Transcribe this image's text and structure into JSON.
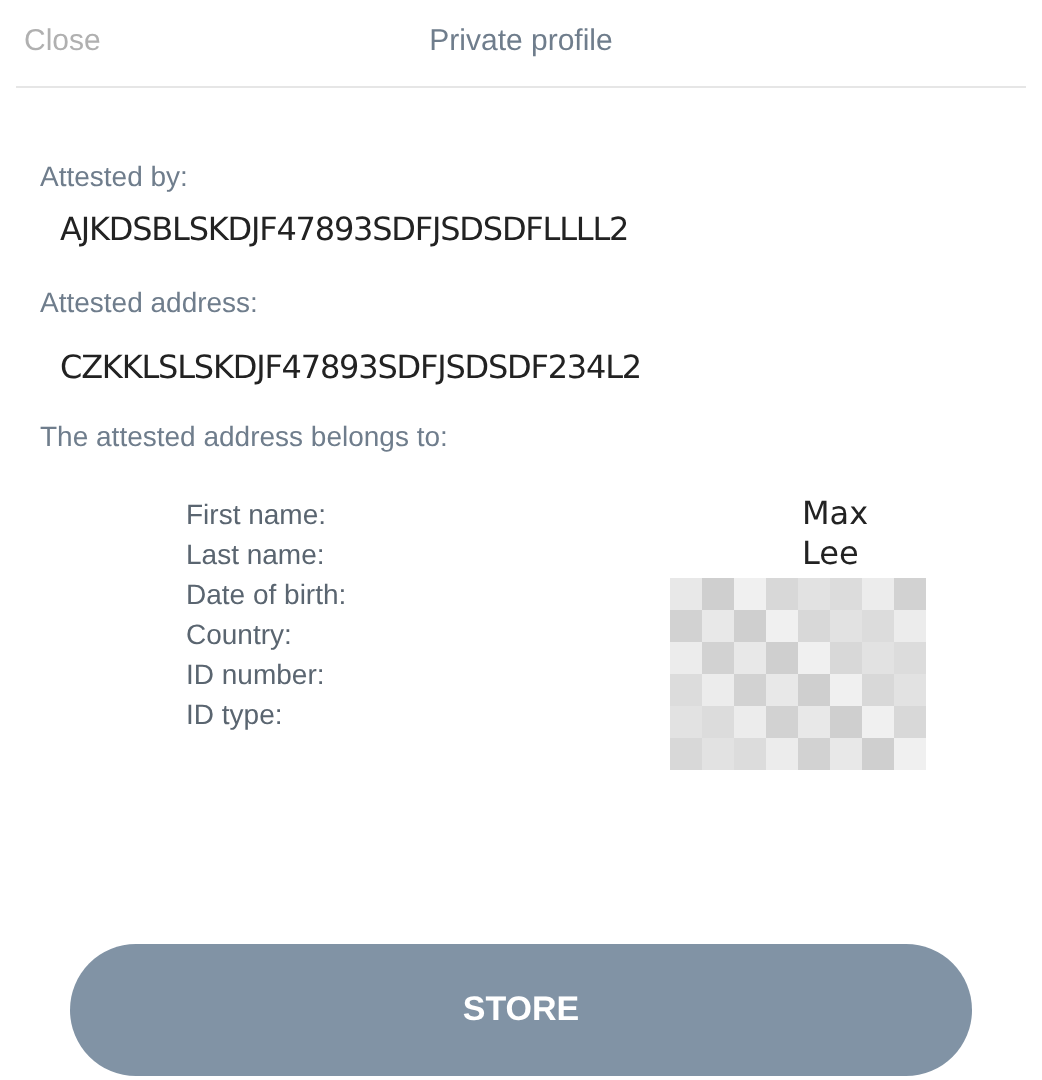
{
  "header": {
    "close": "Close",
    "title": "Private profile"
  },
  "attested_by": {
    "label": "Attested by:",
    "value": "AJKDSBLSKDJF47893SDFJSDSDFLLLL2"
  },
  "attested_address": {
    "label": "Attested address:",
    "value": "CZKKLSLSKDJF47893SDFJSDSDF234L2"
  },
  "belongs_to": {
    "label": "The attested address belongs to:",
    "fields": [
      {
        "label": "First name:",
        "value": "Max"
      },
      {
        "label": "Last name:",
        "value": "Lee"
      },
      {
        "label": "Date of birth:"
      },
      {
        "label": "Country:"
      },
      {
        "label": "ID number:"
      },
      {
        "label": "ID type:"
      }
    ]
  },
  "button": "STORE"
}
